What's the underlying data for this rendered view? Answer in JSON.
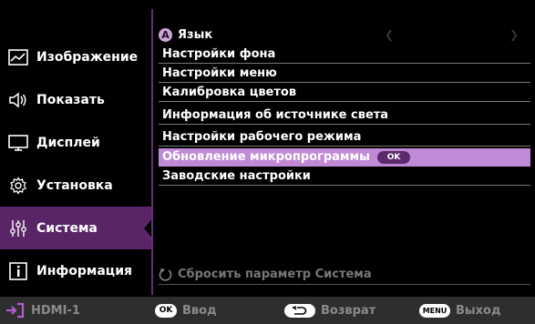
{
  "sidebar": {
    "items": [
      {
        "label": "Изображение",
        "icon": "image-icon"
      },
      {
        "label": "Показать",
        "icon": "speaker-icon"
      },
      {
        "label": "Дисплей",
        "icon": "monitor-icon"
      },
      {
        "label": "Установка",
        "icon": "gear-icon"
      },
      {
        "label": "Система",
        "icon": "sliders-icon",
        "active": true
      },
      {
        "label": "Информация",
        "icon": "info-icon"
      }
    ]
  },
  "menu": {
    "language_badge": "A",
    "language_label": "Язык",
    "items": [
      {
        "label": "Настройки фона"
      },
      {
        "label": "Настройки меню"
      },
      {
        "label": "Калибровка цветов"
      },
      {
        "label": "Информация об источнике света"
      },
      {
        "label": "Настройки рабочего режима"
      },
      {
        "label": "Обновление микропрограммы",
        "selected": true,
        "ok_label": "OK"
      },
      {
        "label": "Заводские настройки"
      }
    ],
    "reset_label": "Сбросить параметр Система"
  },
  "bottom_bar": {
    "source_label": "HDMI-1",
    "ok_pill": "OK",
    "enter_label": "Ввод",
    "return_label": "Возврат",
    "menu_pill": "MENU",
    "exit_label": "Выход"
  },
  "colors": {
    "active_sidebar": "#5a2567",
    "selected_item": "#c18ad6",
    "accent_purple": "#6a2c7a",
    "bottom_bar": "#2e2e2e"
  }
}
